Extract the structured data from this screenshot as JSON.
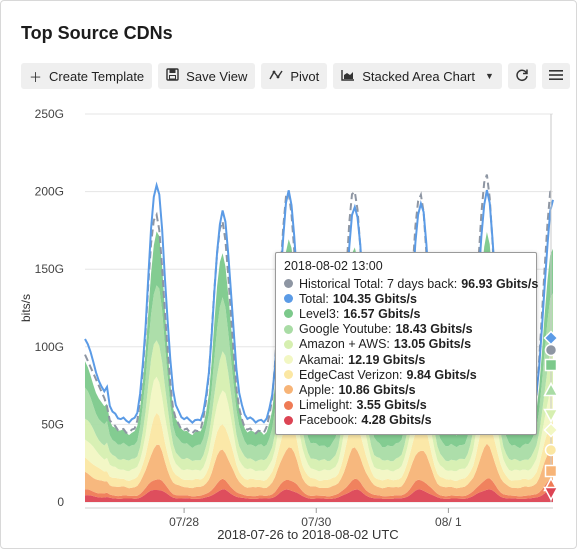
{
  "panel": {
    "title": "Top Source CDNs"
  },
  "toolbar": {
    "create_template": "Create Template",
    "save_view": "Save View",
    "pivot": "Pivot",
    "chart_type": "Stacked Area Chart"
  },
  "tooltip": {
    "date": "2018-08-02 13:00",
    "rows": [
      {
        "label": "Historical Total: 7 days back:",
        "value": "96.93 Gbits/s",
        "color": "#8e96a3"
      },
      {
        "label": "Total:",
        "value": "104.35 Gbits/s",
        "color": "#5b9be6"
      },
      {
        "label": "Level3:",
        "value": "16.57 Gbits/s",
        "color": "#7cc98b"
      },
      {
        "label": "Google Youtube:",
        "value": "18.43 Gbits/s",
        "color": "#a9dca5"
      },
      {
        "label": "Amazon + AWS:",
        "value": "13.05 Gbits/s",
        "color": "#d6efb0"
      },
      {
        "label": "Akamai:",
        "value": "12.19 Gbits/s",
        "color": "#f2f7c3"
      },
      {
        "label": "EdgeCast Verizon:",
        "value": "9.84 Gbits/s",
        "color": "#fbe7a3"
      },
      {
        "label": "Apple:",
        "value": "10.86 Gbits/s",
        "color": "#f7b477"
      },
      {
        "label": "Limelight:",
        "value": "3.55 Gbits/s",
        "color": "#ef7b55"
      },
      {
        "label": "Facebook:",
        "value": "4.28 Gbits/s",
        "color": "#dc4454"
      }
    ]
  },
  "chart_data": {
    "type": "area",
    "stacked": true,
    "ylabel": "bits/s",
    "xlabel": "2018-07-26 to 2018-08-02 UTC",
    "yticks": [
      "0",
      "50G",
      "100G",
      "150G",
      "200G",
      "250G"
    ],
    "ylim": [
      0,
      250
    ],
    "y_unit": "Gbits/s",
    "xticks": [
      "07/28",
      "07/30",
      "08/ 1"
    ],
    "x_tick_dates": [
      "2018-07-28",
      "2018-07-30",
      "2018-08-01"
    ],
    "xlim": [
      "2018-07-26 12:00",
      "2018-08-02 14:00"
    ],
    "grid": true,
    "daily_peaks": {
      "dates": [
        "2018-07-26",
        "2018-07-27",
        "2018-07-28",
        "2018-07-29",
        "2018-07-30",
        "2018-07-31",
        "2018-08-01",
        "2018-08-02"
      ],
      "peak_time": "~14:00",
      "total": [
        null,
        205,
        187,
        200,
        191,
        193,
        200,
        194
      ],
      "historical_total": [
        null,
        196,
        190,
        210,
        212,
        209,
        221,
        213
      ],
      "total_trough": 55
    },
    "series": [
      {
        "name": "Facebook",
        "color": "#dc4454",
        "share": 0.041
      },
      {
        "name": "Limelight",
        "color": "#ef7b55",
        "share": 0.034
      },
      {
        "name": "Apple",
        "color": "#f7b477",
        "share": 0.104
      },
      {
        "name": "EdgeCast Verizon",
        "color": "#fbe7a3",
        "share": 0.094
      },
      {
        "name": "Akamai",
        "color": "#f2f7c3",
        "share": 0.117
      },
      {
        "name": "Amazon + AWS",
        "color": "#d6efb0",
        "share": 0.125
      },
      {
        "name": "Google Youtube",
        "color": "#a9dca5",
        "share": 0.177
      },
      {
        "name": "Level3",
        "color": "#7cc98b",
        "share": 0.159
      }
    ],
    "line_series": [
      {
        "name": "Total",
        "color": "#5b9be6",
        "style": "solid"
      },
      {
        "name": "Historical Total: 7 days back",
        "color": "#8e96a3",
        "style": "dashed"
      }
    ],
    "right_edge_markers": [
      {
        "shape": "diamond",
        "color": "#5b9be6"
      },
      {
        "shape": "circle",
        "color": "#8e96a3"
      },
      {
        "shape": "square",
        "color": "#7cc98b"
      },
      {
        "shape": "triangle-up",
        "color": "#a9dca5"
      },
      {
        "shape": "triangle-down",
        "color": "#d6efb0"
      },
      {
        "shape": "diamond",
        "color": "#f2f7c3"
      },
      {
        "shape": "circle",
        "color": "#fbe7a3"
      },
      {
        "shape": "square",
        "color": "#f7b477"
      },
      {
        "shape": "triangle-up",
        "color": "#ef7b55"
      },
      {
        "shape": "triangle-down",
        "color": "#dc4454"
      }
    ]
  }
}
